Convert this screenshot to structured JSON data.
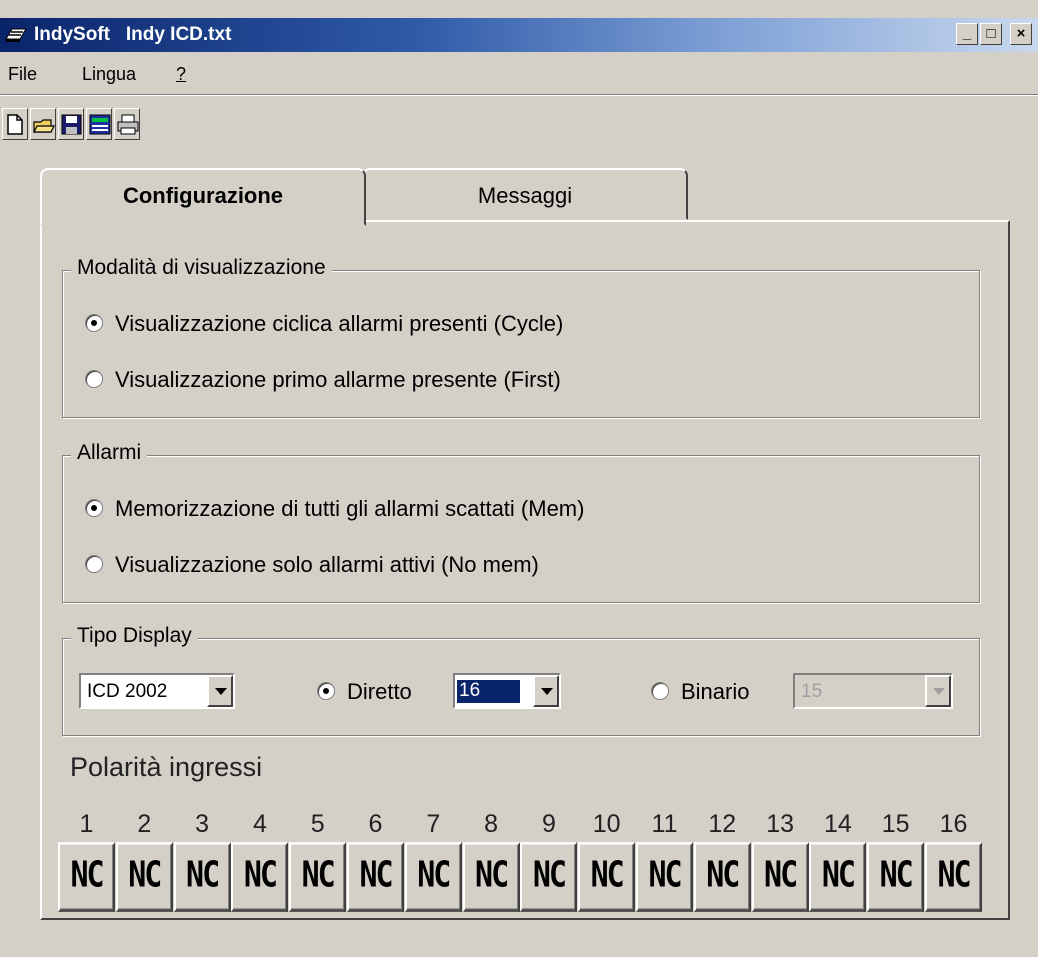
{
  "window": {
    "app_name": "IndySoft",
    "file_name": "Indy ICD.txt",
    "minimize_label": "_",
    "maximize_label": "□",
    "close_label": "×"
  },
  "menu": [
    "File",
    "Lingua",
    "?"
  ],
  "toolbar": {
    "icons": [
      "new-document-icon",
      "open-folder-icon",
      "save-disk-icon",
      "display-monitor-icon",
      "printer-icon"
    ]
  },
  "tabs": [
    {
      "label": "Configurazione",
      "active": true
    },
    {
      "label": "Messaggi",
      "active": false
    }
  ],
  "display_mode": {
    "title": "Modalità di visualizzazione",
    "options": [
      {
        "label": "Visualizzazione ciclica allarmi presenti (Cycle)",
        "checked": true
      },
      {
        "label": "Visualizzazione primo allarme presente (First)",
        "checked": false
      }
    ]
  },
  "alarms": {
    "title": "Allarmi",
    "options": [
      {
        "label": "Memorizzazione di tutti gli allarmi scattati (Mem)",
        "checked": true
      },
      {
        "label": "Visualizzazione solo allarmi attivi (No mem)",
        "checked": false
      }
    ]
  },
  "display_type": {
    "title": "Tipo Display",
    "model": "ICD 2002",
    "direct_label": "Diretto",
    "direct_checked": true,
    "direct_value": "16",
    "binary_label": "Binario",
    "binary_checked": false,
    "binary_value": "15"
  },
  "polarity": {
    "title": "Polarità ingressi",
    "inputs": [
      "1",
      "2",
      "3",
      "4",
      "5",
      "6",
      "7",
      "8",
      "9",
      "10",
      "11",
      "12",
      "13",
      "14",
      "15",
      "16"
    ],
    "values": [
      "NC",
      "NC",
      "NC",
      "NC",
      "NC",
      "NC",
      "NC",
      "NC",
      "NC",
      "NC",
      "NC",
      "NC",
      "NC",
      "NC",
      "NC",
      "NC"
    ]
  },
  "colors": {
    "titlebar_start": "#0a246a",
    "titlebar_end": "#c9d8ee",
    "window_bg": "#d4d0c8",
    "selection": "#0a246a"
  }
}
